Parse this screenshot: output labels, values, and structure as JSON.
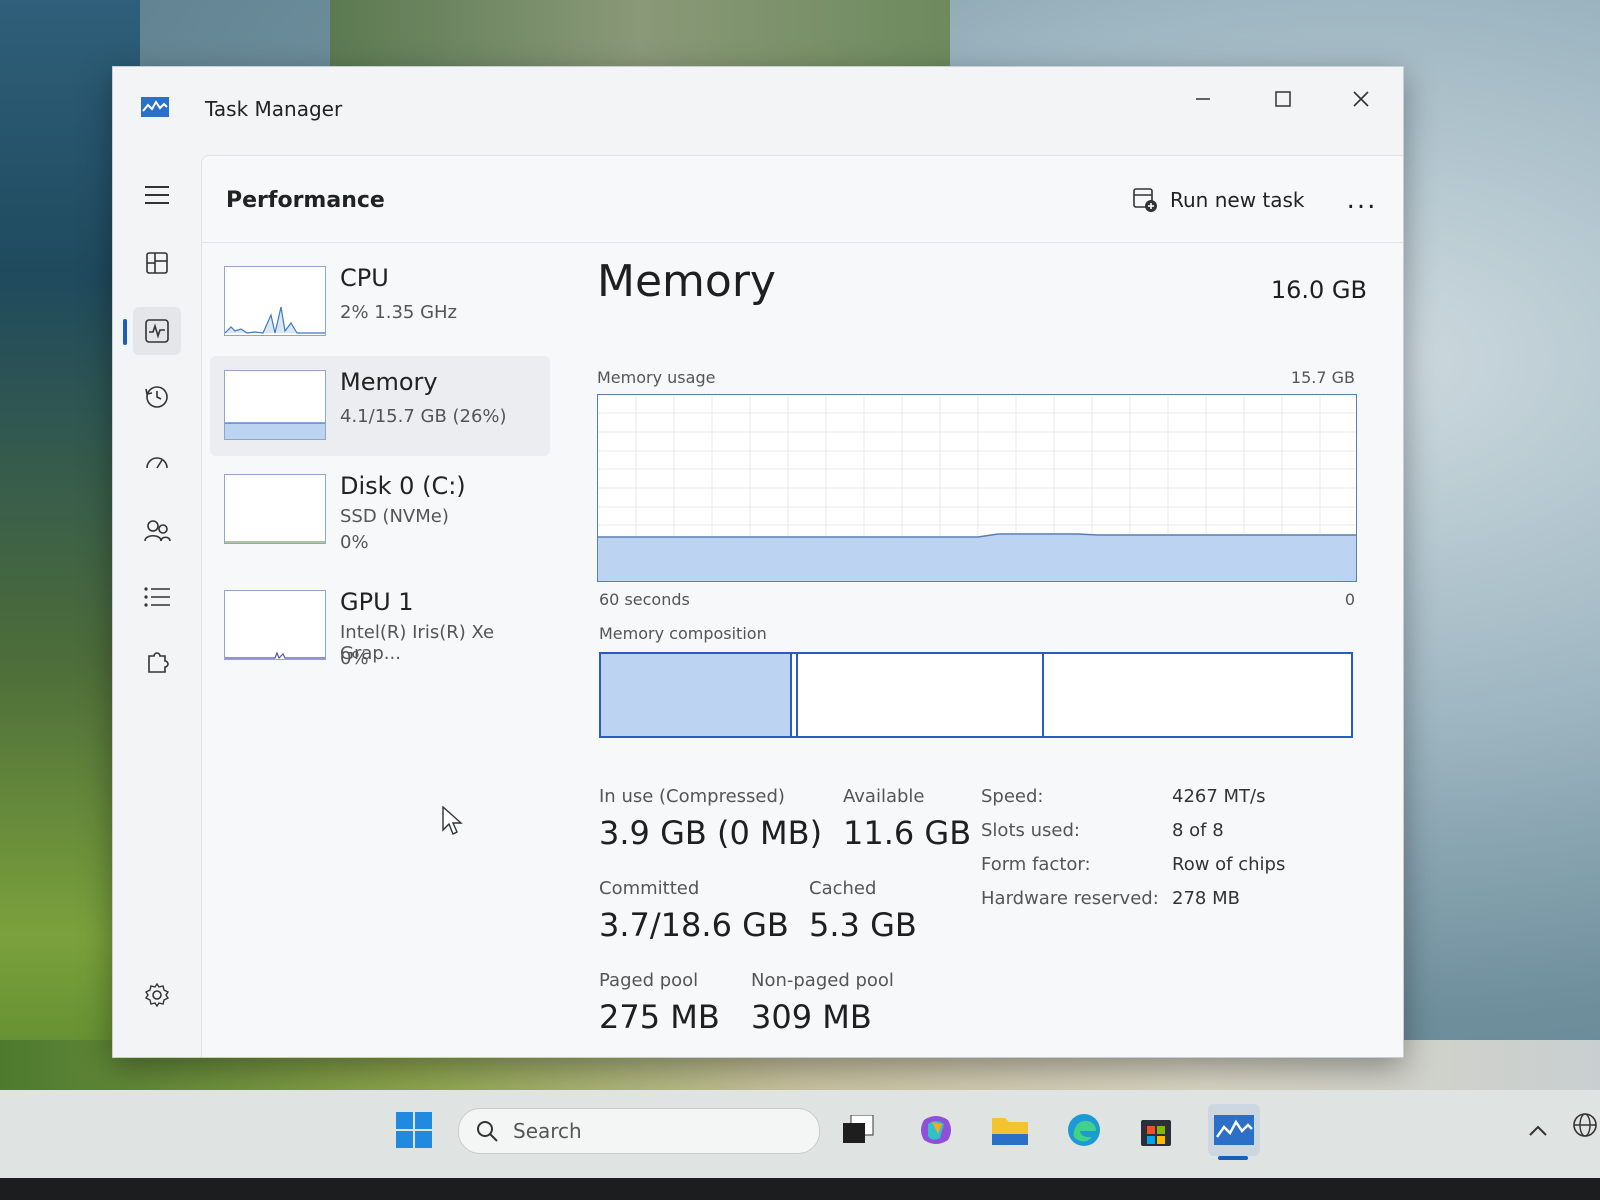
{
  "window": {
    "title": "Task Manager"
  },
  "header": {
    "title": "Performance",
    "run_new_task": "Run new task",
    "more": "..."
  },
  "devices": [
    {
      "name": "CPU",
      "line1": "2%  1.35 GHz",
      "line2": ""
    },
    {
      "name": "Memory",
      "line1": "4.1/15.7 GB (26%)",
      "line2": ""
    },
    {
      "name": "Disk 0 (C:)",
      "line1": "SSD (NVMe)",
      "line2": "0%"
    },
    {
      "name": "GPU 1",
      "line1": "Intel(R) Iris(R) Xe Grap...",
      "line2": "0%"
    }
  ],
  "memory": {
    "title": "Memory",
    "total": "16.0 GB",
    "usage_label": "Memory usage",
    "usage_max": "15.7 GB",
    "time_label": "60 seconds",
    "time_end": "0",
    "composition_label": "Memory composition",
    "in_use_label": "In use (Compressed)",
    "in_use_value": "3.9 GB (0 MB)",
    "available_label": "Available",
    "available_value": "11.6 GB",
    "committed_label": "Committed",
    "committed_value": "3.7/18.6 GB",
    "cached_label": "Cached",
    "cached_value": "5.3 GB",
    "paged_label": "Paged pool",
    "paged_value": "275 MB",
    "nonpaged_label": "Non-paged pool",
    "nonpaged_value": "309 MB",
    "specs": [
      {
        "label": "Speed:",
        "value": "4267 MT/s"
      },
      {
        "label": "Slots used:",
        "value": "8 of 8"
      },
      {
        "label": "Form factor:",
        "value": "Row of chips"
      },
      {
        "label": "Hardware reserved:",
        "value": "278 MB"
      }
    ]
  },
  "taskbar": {
    "search_placeholder": "Search"
  },
  "colors": {
    "accent": "#1a5fb4",
    "graph_fill": "#bcd3f2",
    "graph_line": "#5a7fb0"
  }
}
